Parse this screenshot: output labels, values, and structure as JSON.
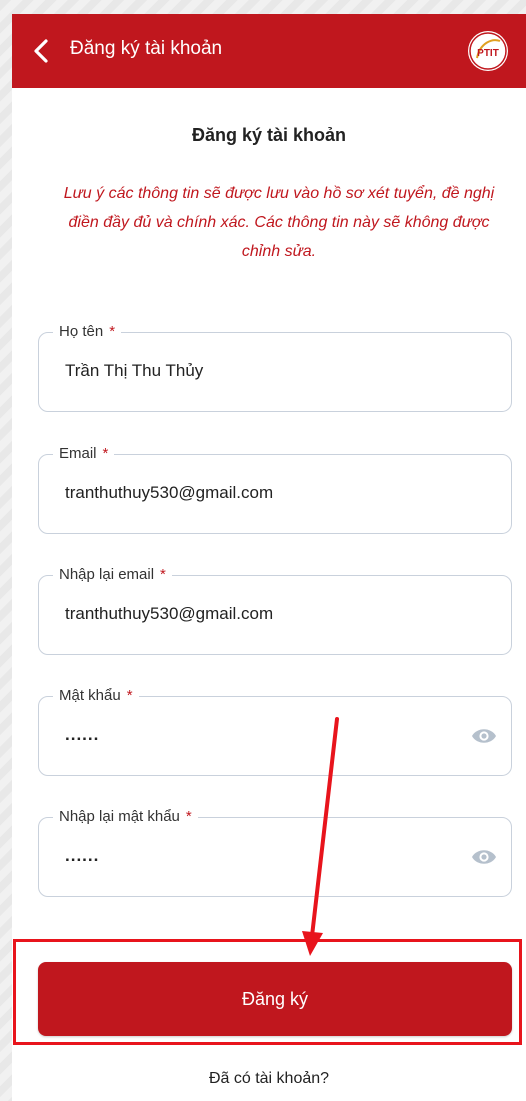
{
  "header": {
    "title": "Đăng ký tài khoản",
    "back_icon": "chevron-left-icon",
    "logo_icon": "ptit-logo",
    "logo_text": "PTIT"
  },
  "page": {
    "title": "Đăng ký tài khoản",
    "notice": "Lưu ý các thông tin sẽ được lưu vào hồ sơ xét tuyển, đề nghị điền đầy đủ và chính xác. Các thông tin này sẽ không được chỉnh sửa."
  },
  "form": {
    "fullname": {
      "label": "Họ tên",
      "required": "*",
      "value": "Trần Thị Thu Thủy"
    },
    "email": {
      "label": "Email",
      "required": "*",
      "value": "tranthuthuy530@gmail.com"
    },
    "email_confirm": {
      "label": "Nhập lại email",
      "required": "*",
      "value": "tranthuthuy530@gmail.com"
    },
    "password": {
      "label": "Mật khẩu",
      "required": "*",
      "value": "......",
      "icon": "eye-icon"
    },
    "password_confirm": {
      "label": "Nhập lại mật khẩu",
      "required": "*",
      "value": "......",
      "icon": "eye-icon"
    },
    "submit_label": "Đăng ký"
  },
  "footer": {
    "login_link": "Đã có tài khoản?"
  },
  "colors": {
    "brand": "#c0171e",
    "annotation": "#e8141c",
    "border": "#c9d1dc"
  }
}
